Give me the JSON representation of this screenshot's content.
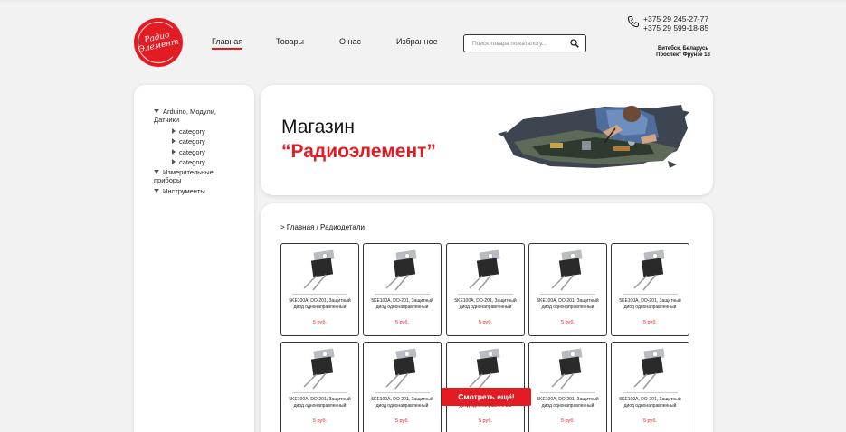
{
  "brand": {
    "logo_text_line1": "Радио",
    "logo_text_line2": "Элемент",
    "accent_color": "#e31b23"
  },
  "nav": {
    "items": [
      {
        "label": "Главная",
        "active": true
      },
      {
        "label": "Товары",
        "active": false
      },
      {
        "label": "О нас",
        "active": false
      },
      {
        "label": "Избранное",
        "active": false
      }
    ]
  },
  "search": {
    "placeholder": "Поиск товара по каталогу...",
    "value": "",
    "icon": "search-icon"
  },
  "contacts": {
    "phone_icon": "phone-icon",
    "phones": [
      "+375 29 245-27-77",
      "+375 29 599-18-85"
    ],
    "address": "Витебск, Беларусь Проспект Фрунзе 18"
  },
  "sidebar": {
    "categories": [
      {
        "label": "Arduino, Модули, Датчики",
        "expanded": true
      },
      {
        "label": "Измерительные приборы",
        "expanded": true
      },
      {
        "label": "Инструменты",
        "expanded": true
      }
    ],
    "subcategories": [
      "category",
      "category",
      "category",
      "category"
    ]
  },
  "hero": {
    "title": "Магазин",
    "subtitle": "“Радиоэлемент”"
  },
  "breadcrumb": "> Главная / Радиодетали",
  "products": [
    {
      "name": "5KE100A, DO-201, Защитный диод однонаправленный",
      "price": "5 руб."
    },
    {
      "name": "5KE100A, DO-201, Защитный диод однонаправленный",
      "price": "5 руб."
    },
    {
      "name": "5KE100A, DO-201, Защитный диод однонаправленный",
      "price": "5 руб."
    },
    {
      "name": "5KE100A, DO-201, Защитный диод однонаправленный",
      "price": "5 руб."
    },
    {
      "name": "5KE100A, DO-201, Защитный диод однонаправленный",
      "price": "5 руб."
    },
    {
      "name": "5KE100A, DO-201, Защитный диод однонаправленный",
      "price": "5 руб."
    },
    {
      "name": "5KE100A, DO-201, Защитный диод однонаправленный",
      "price": "5 руб."
    },
    {
      "name": "5KE100A, DO-201, Защитный диод однонаправленный",
      "price": "5 руб."
    },
    {
      "name": "5KE100A, DO-201, Защитный диод однонаправленный",
      "price": "5 руб."
    },
    {
      "name": "5KE100A, DO-201, Защитный диод однонаправленный",
      "price": "5 руб."
    }
  ],
  "more_button": "Смотреть ещё!"
}
